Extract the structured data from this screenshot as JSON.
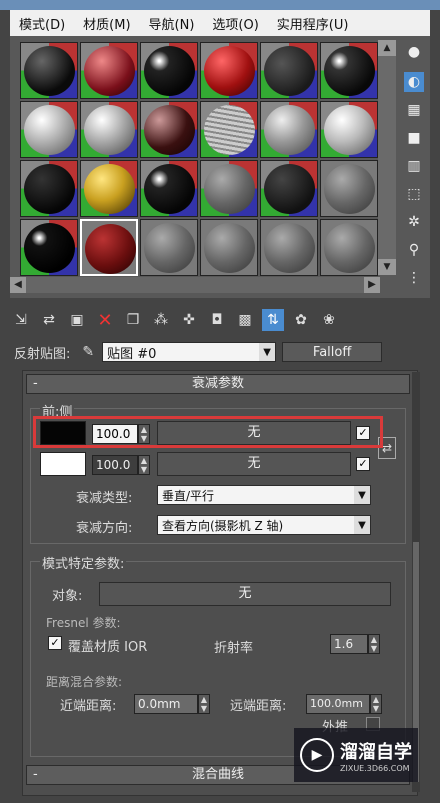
{
  "menu": [
    "模式(D)",
    "材质(M)",
    "导航(N)",
    "选项(O)",
    "实用程序(U)"
  ],
  "reflect": {
    "label": "反射贴图:",
    "map_name": "贴图 #0",
    "map_type": "Falloff"
  },
  "falloff_params": {
    "title": "衰减参数",
    "front_side_label": "前:侧",
    "row1": {
      "value": "100.0",
      "map_label": "无",
      "checked": true
    },
    "row2": {
      "value": "100.0",
      "map_label": "无",
      "checked": true
    },
    "falloff_type_label": "衰减类型:",
    "falloff_type_value": "垂直/平行",
    "falloff_dir_label": "衰减方向:",
    "falloff_dir_value": "查看方向(摄影机 Z 轴)"
  },
  "mode_params": {
    "title": "模式特定参数:",
    "object_label": "对象:",
    "object_value": "无",
    "fresnel_label": "Fresnel 参数:",
    "override_ior_label": "覆盖材质 IOR",
    "override_ior_checked": true,
    "ior_label": "折射率",
    "ior_value": "1.6",
    "dist_blend_label": "距离混合参数:",
    "near_label": "近端距离:",
    "near_value": "0.0mm",
    "far_label": "远端距离:",
    "far_value": "100.0mm",
    "extrapolate_label": "外推"
  },
  "mix_curve": {
    "title": "混合曲线"
  },
  "watermark": {
    "brand": "溜溜自学",
    "url": "ZIXUE.3D66.COM"
  },
  "toolbar_icons": [
    "get-material-icon",
    "put-to-scene-icon",
    "assign-icon",
    "reset-icon",
    "make-copy-icon",
    "make-unique-icon",
    "put-to-library-icon",
    "material-id-icon",
    "show-map-icon",
    "show-end-result-icon",
    "go-parent-icon",
    "go-sibling-icon"
  ]
}
